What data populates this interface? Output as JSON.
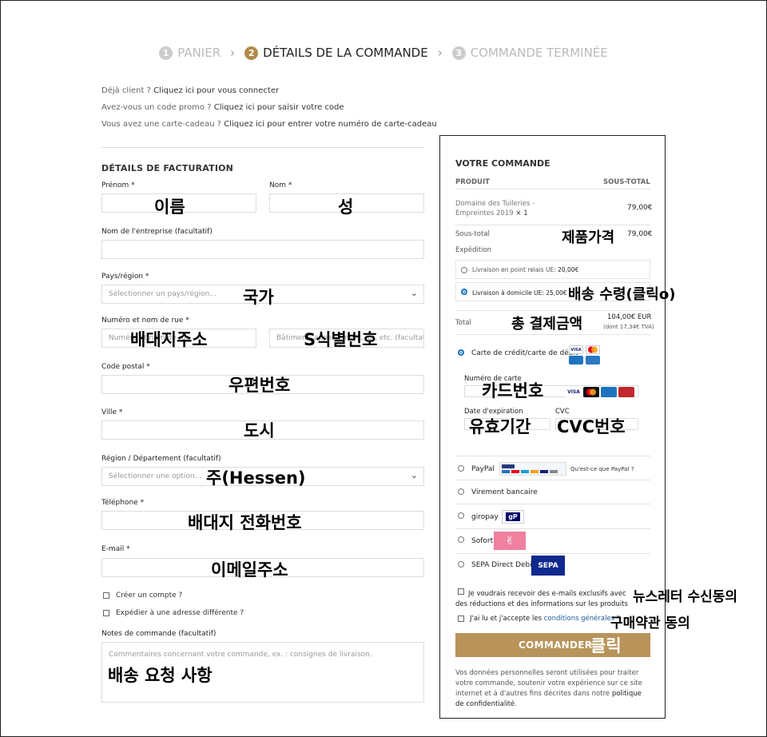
{
  "steps": [
    {
      "num": "1",
      "label": "PANIER"
    },
    {
      "num": "2",
      "label": "DÉTAILS DE LA COMMANDE"
    },
    {
      "num": "3",
      "label": "COMMANDE TERMINÉE"
    }
  ],
  "notices": {
    "login_prefix": "Déjà client ? ",
    "login_link": "Cliquez ici pour vous connecter",
    "promo_prefix": "Avez-vous un code promo ? ",
    "promo_link": "Cliquez ici pour saisir votre code",
    "gift_prefix": "Vous avez une carte-cadeau ? ",
    "gift_link": "Cliquez ici pour entrer votre numéro de carte-cadeau"
  },
  "billing": {
    "heading": "DÉTAILS DE FACTURATION",
    "firstname_label": "Prénom *",
    "firstname_note": "이름",
    "lastname_label": "Nom *",
    "lastname_note": "성",
    "company_label": "Nom de l'entreprise (facultatif)",
    "country_label": "Pays/région *",
    "country_placeholder": "Sélectionner un pays/région...",
    "country_note": "국가",
    "street_label": "Numéro et nom de rue *",
    "street_placeholder": "Numéro et nom de rue",
    "street_note": "배대지주소",
    "apt_placeholder": "Bâtiment, appartement, lot, etc. (facultatif)",
    "apt_note": "S식별번호",
    "postcode_label": "Code postal *",
    "postcode_note": "우편번호",
    "city_label": "Ville *",
    "city_note": "도시",
    "region_label": "Région / Département (facultatif)",
    "region_placeholder": "Sélectionner une option...",
    "region_note": "주(Hessen)",
    "phone_label": "Téléphone *",
    "phone_note": "배대지 전화번호",
    "email_label": "E-mail *",
    "email_note": "이메일주소",
    "create_account": "Créer un compte ?",
    "ship_different": "Expédier à une adresse différente ?",
    "notes_label": "Notes de commande (facultatif)",
    "notes_placeholder": "Commentaires concernant votre commande, ex. : consignes de livraison.",
    "notes_note": "배송 요청 사항"
  },
  "order": {
    "heading": "VOTRE COMMANDE",
    "col_product": "PRODUIT",
    "col_subtotal": "SOUS-TOTAL",
    "product_name": "Domaine des Tuileries - Empreintes 2019",
    "product_qty": "× 1",
    "product_price": "79,00€",
    "subtotal_label": "Sous-total",
    "subtotal_value": "79,00€",
    "subtotal_note": "제품가격",
    "shipping_label": "Expédition",
    "ship_option1": "Livraison en point relais UE:",
    "ship_option1_price": "20,00€",
    "ship_option2": "Livraison à domicile UE:",
    "ship_option2_price": "25,00€",
    "ship_note": "배송 수령(클릭o)",
    "total_label": "Total",
    "total_value": "104,00€ EUR",
    "total_tax": "(dont 17,34€ TVA)",
    "total_note": "총 결제금액",
    "card_label": "Carte de crédit/carte de débit",
    "card_number_label": "Numéro de carte",
    "card_number_note": "카드번호",
    "expiry_label": "Date d'expiration",
    "expiry_note": "유효기간",
    "cvc_label": "CVC",
    "cvc_note": "CVC번호",
    "paypal_label": "PayPal",
    "paypal_link": "Qu'est-ce que PayPal ?",
    "virement_label": "Virement bancaire",
    "giropay_label": "giropay",
    "sofort_label": "Sofort",
    "sepa_label": "SEPA Direct Debit",
    "newsletter_text": "Je voudrais recevoir des e-mails exclusifs avec des réductions et des informations sur les produits",
    "newsletter_note": "뉴스레터 수신동의",
    "terms_prefix": "J'ai lu et j'accepte les ",
    "terms_link": "conditions générales",
    "terms_suffix": " *",
    "terms_note": "구매약관 동의",
    "submit_label": "COMMANDER",
    "submit_note": "클릭",
    "privacy_text": "Vos données personnelles seront utilisées pour traiter votre commande, soutenir votre expérience sur ce site internet et à d'autres fins décrites dans notre ",
    "privacy_link": "politique de confidentialité",
    "privacy_end": "."
  },
  "logos": {
    "visa": "VISA",
    "gp": "gP",
    "sepa": "SEPA"
  },
  "colors": {
    "accent": "#b8945a",
    "radio": "#1b74c4"
  }
}
